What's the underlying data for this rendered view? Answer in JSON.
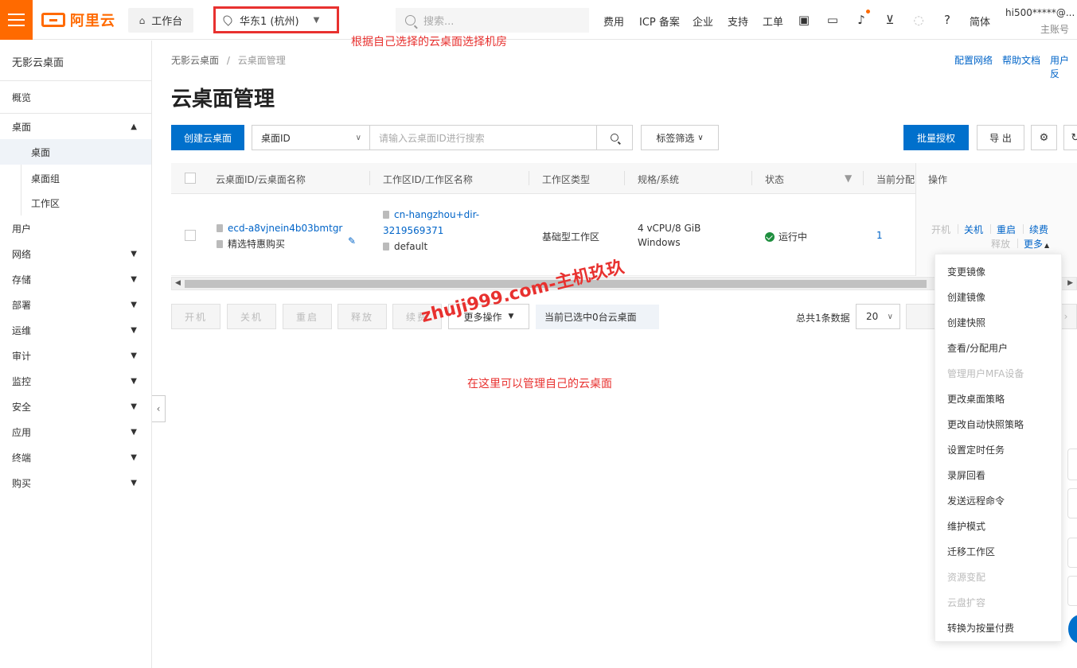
{
  "topbar": {
    "logo_text": "阿里云",
    "workspace_label": "工作台",
    "region_label": "华东1 (杭州)",
    "search_placeholder": "搜索...",
    "links": [
      "费用",
      "ICP 备案",
      "企业",
      "支持",
      "工单"
    ],
    "lang_label": "简体",
    "user_name": "hi500*****@...",
    "user_role": "主账号"
  },
  "annotations": {
    "region_tip": "根据自己选择的云桌面选择机房",
    "manage_tip": "在这里可以管理自己的云桌面",
    "watermark": "zhuji999.com-主机玖玖"
  },
  "sidebar": {
    "title": "无影云桌面",
    "overview": "概览",
    "desktop_group": "桌面",
    "desktop_sub": [
      "桌面",
      "桌面组",
      "工作区"
    ],
    "items": [
      "用户",
      "网络",
      "存储",
      "部署",
      "运维",
      "审计",
      "监控",
      "安全",
      "应用",
      "终端",
      "购买"
    ]
  },
  "breadcrumb": {
    "root": "无影云桌面",
    "separator": "/",
    "current": "云桌面管理"
  },
  "header_links": [
    "配置网络",
    "帮助文档",
    "用户反"
  ],
  "page_title": "云桌面管理",
  "toolbar": {
    "create_label": "创建云桌面",
    "filter_select": "桌面ID",
    "search_placeholder": "请输入云桌面ID进行搜索",
    "tag_filter": "标签筛选",
    "batch_auth": "批量授权",
    "export": "导 出"
  },
  "table": {
    "columns": [
      "云桌面ID/云桌面名称",
      "工作区ID/工作区名称",
      "工作区类型",
      "规格/系统",
      "状态",
      "当前分配",
      "操作"
    ],
    "row": {
      "desktop_id": "ecd-a8vjnein4b03bmtgr",
      "desktop_name": "精选特惠购买",
      "workspace_id_1": "cn-hangzhou+dir-",
      "workspace_id_2": "3219569371",
      "workspace_name": "default",
      "workspace_type": "基础型工作区",
      "spec": "4 vCPU/8 GiB",
      "os": "Windows",
      "status": "运行中",
      "assigned": "1",
      "ops": {
        "start": "开机",
        "stop": "关机",
        "restart": "重启",
        "renew": "续费",
        "release": "释放",
        "more": "更多"
      }
    }
  },
  "bulk_actions": {
    "start": "开机",
    "stop": "关机",
    "restart": "重启",
    "release": "释放",
    "renew": "续费",
    "more": "更多操作",
    "selected_info": "当前已选中0台云桌面"
  },
  "pager": {
    "total": "总共1条数据",
    "page_size": "20"
  },
  "more_menu": [
    {
      "label": "变更镜像",
      "disabled": false
    },
    {
      "label": "创建镜像",
      "disabled": false
    },
    {
      "label": "创建快照",
      "disabled": false
    },
    {
      "label": "查看/分配用户",
      "disabled": false
    },
    {
      "label": "管理用户MFA设备",
      "disabled": true
    },
    {
      "label": "更改桌面策略",
      "disabled": false
    },
    {
      "label": "更改自动快照策略",
      "disabled": false
    },
    {
      "label": "设置定时任务",
      "disabled": false
    },
    {
      "label": "录屏回看",
      "disabled": false
    },
    {
      "label": "发送远程命令",
      "disabled": false
    },
    {
      "label": "维护模式",
      "disabled": false
    },
    {
      "label": "迁移工作区",
      "disabled": false
    },
    {
      "label": "资源变配",
      "disabled": true
    },
    {
      "label": "云盘扩容",
      "disabled": true
    },
    {
      "label": "转换为按量付费",
      "disabled": false
    }
  ],
  "colors": {
    "brand": "#ff6a00",
    "primary": "#0070cc",
    "link": "#0064c8",
    "annotation": "#e8312f",
    "success": "#1e8e3e"
  }
}
